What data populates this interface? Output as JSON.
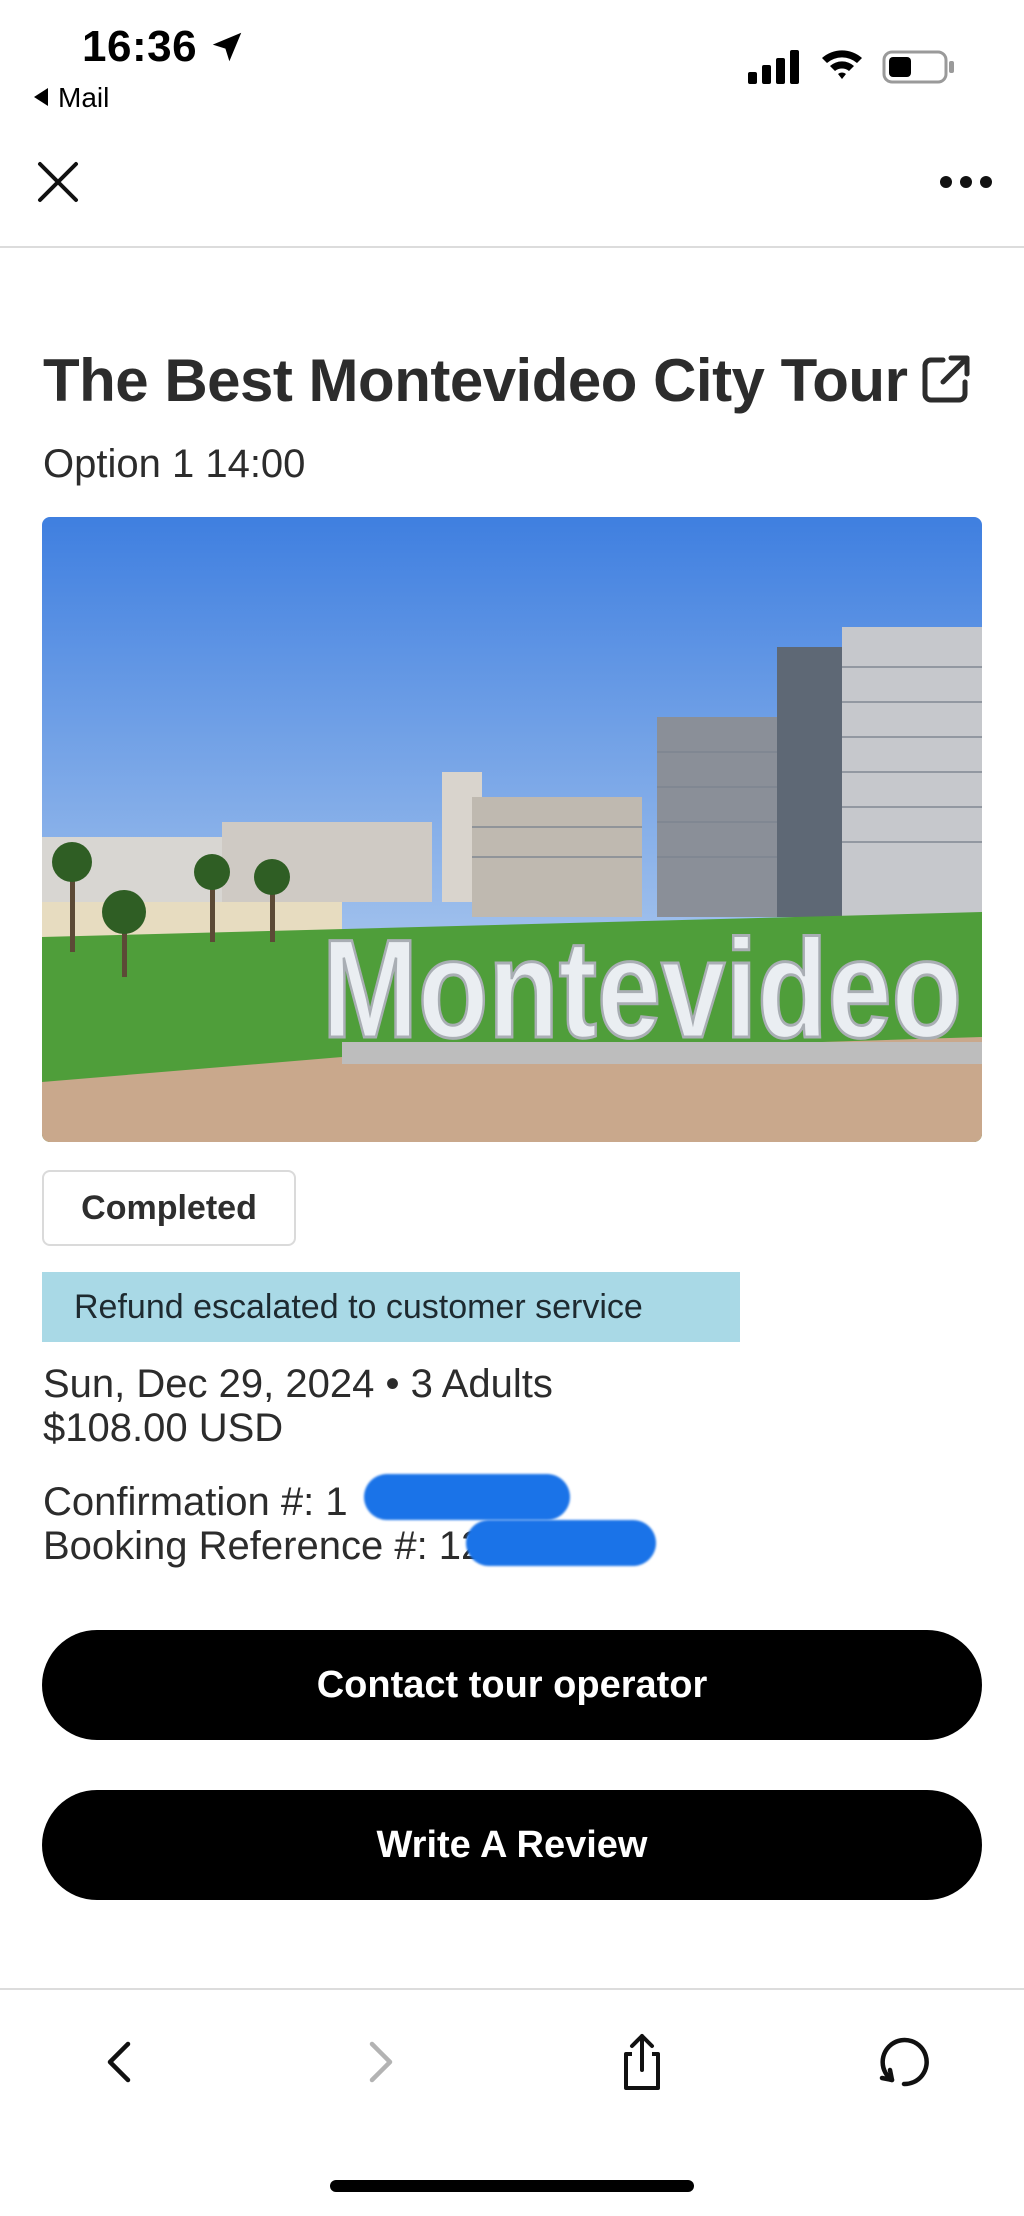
{
  "status_bar": {
    "time": "16:36",
    "back_app": "Mail"
  },
  "tour": {
    "title": "The Best Montevideo City Tour",
    "option": "Option 1 14:00",
    "hero_sign_text": "Montevideo",
    "status": "Completed",
    "refund_banner": "Refund escalated to customer service",
    "date_and_guests": "Sun, Dec 29, 2024 • 3 Adults",
    "price": "$108.00 USD",
    "confirmation_label": "Confirmation #: 1",
    "booking_reference_label": "Booking Reference #: 12",
    "redaction_color": "#1a73e8"
  },
  "actions": {
    "contact_label": "Contact tour operator",
    "review_label": "Write A Review"
  },
  "colors": {
    "banner_bg": "#a9d9e6",
    "button_bg": "#000000",
    "button_text": "#ffffff"
  },
  "icons": {
    "close": "close-icon",
    "more": "more-icon",
    "external_link": "external-link-icon",
    "back": "chevron-left-icon",
    "forward": "chevron-right-icon",
    "share": "share-icon",
    "refresh": "refresh-icon"
  }
}
